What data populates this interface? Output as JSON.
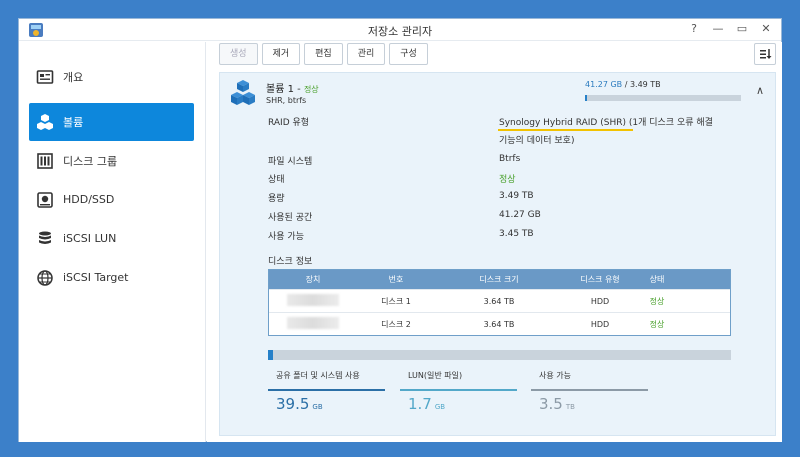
{
  "window": {
    "title": "저장소 관리자"
  },
  "sidebar": {
    "items": [
      {
        "label": "개요",
        "icon": "overview-icon"
      },
      {
        "label": "볼륨",
        "icon": "volume-icon"
      },
      {
        "label": "디스크 그룹",
        "icon": "disk-group-icon"
      },
      {
        "label": "HDD/SSD",
        "icon": "hdd-icon"
      },
      {
        "label": "iSCSI LUN",
        "icon": "iscsi-lun-icon"
      },
      {
        "label": "iSCSI Target",
        "icon": "iscsi-target-icon"
      }
    ]
  },
  "toolbar": {
    "create": "생성",
    "remove": "제거",
    "edit": "편집",
    "manage": "관리",
    "configure": "구성"
  },
  "volume": {
    "name": "볼륨 1",
    "separator": "-",
    "status": "정상",
    "subtitle": "SHR, btrfs",
    "used": "41.27 GB",
    "total": "3.49 TB",
    "usage_fraction": 0.012
  },
  "properties": {
    "raid_type_label": "RAID 유형",
    "raid_type_value": "Synology Hybrid RAID (SHR)",
    "raid_type_note": "(1개 디스크 오류 해결",
    "raid_type_note2": "기능의 데이터 보호)",
    "filesystem_label": "파일 시스템",
    "filesystem_value": "Btrfs",
    "status_label": "상태",
    "status_value": "정상",
    "capacity_label": "용량",
    "capacity_value": "3.49 TB",
    "used_label": "사용된 공간",
    "used_value": "41.27 GB",
    "available_label": "사용 가능",
    "available_value": "3.45 TB"
  },
  "disk_info": {
    "title": "디스크 정보",
    "headers": [
      "장치",
      "번호",
      "디스크 크기",
      "디스크 유형",
      "상태"
    ],
    "rows": [
      {
        "number": "디스크 1",
        "size": "3.64 TB",
        "type": "HDD",
        "status": "정상"
      },
      {
        "number": "디스크 2",
        "size": "3.64 TB",
        "type": "HDD",
        "status": "정상"
      }
    ]
  },
  "stats": {
    "usage_fraction": 0.011,
    "shared": {
      "label": "공유 폴더 및 시스템 사용",
      "value": "39.5",
      "unit": "GB"
    },
    "lun": {
      "label": "LUN(일반 파일)",
      "value": "1.7",
      "unit": "GB"
    },
    "available": {
      "label": "사용 가능",
      "value": "3.5",
      "unit": "TB"
    }
  },
  "colors": {
    "accent": "#0d87dc",
    "status_ok": "#4aa02c",
    "shared": "#2b6fa6",
    "lun": "#53a8c9",
    "available": "#8c9aa6"
  }
}
